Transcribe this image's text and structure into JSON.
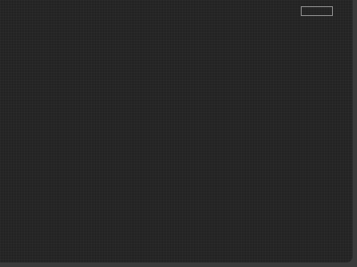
{
  "window": {
    "background_color": "#3a3a3a"
  },
  "canvas": {
    "background_color": "#232323"
  },
  "corner_button": {
    "label": "",
    "border_color": "#8c8c8c"
  }
}
